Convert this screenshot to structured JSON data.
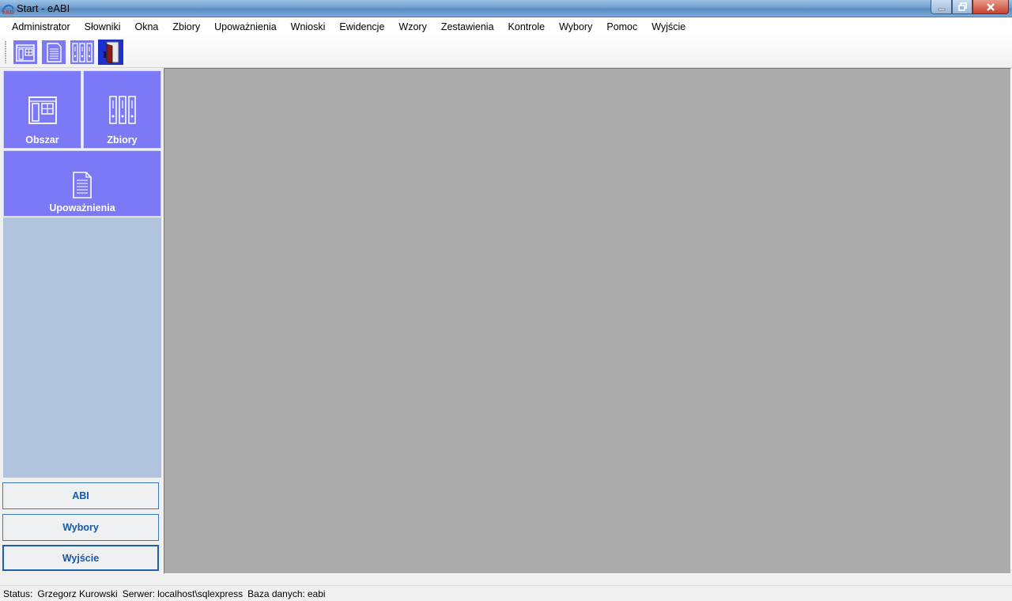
{
  "window": {
    "title": "Start - eABI",
    "app_icon": "eabi-logo-icon",
    "minimize_icon": "minimize-icon",
    "maximize_icon": "restore-icon",
    "close_icon": "close-icon"
  },
  "menu": {
    "items": [
      {
        "label": "Administrator"
      },
      {
        "label": "Słowniki"
      },
      {
        "label": "Okna"
      },
      {
        "label": "Zbiory"
      },
      {
        "label": "Upoważnienia"
      },
      {
        "label": "Wnioski"
      },
      {
        "label": "Ewidencje"
      },
      {
        "label": "Wzory"
      },
      {
        "label": "Zestawienia"
      },
      {
        "label": "Kontrole"
      },
      {
        "label": "Wybory"
      },
      {
        "label": "Pomoc"
      },
      {
        "label": "Wyjście"
      }
    ]
  },
  "toolbar": {
    "buttons": [
      {
        "icon": "obszar-icon"
      },
      {
        "icon": "document-icon"
      },
      {
        "icon": "binders-icon"
      },
      {
        "icon": "exit-door-icon"
      }
    ]
  },
  "sidebar": {
    "tiles": [
      {
        "label": "Obszar",
        "icon": "obszar-icon"
      },
      {
        "label": "Zbiory",
        "icon": "binders-icon"
      },
      {
        "label": "Upoważnienia",
        "icon": "document-icon"
      }
    ],
    "nav_buttons": [
      {
        "label": "ABI"
      },
      {
        "label": "Wybory"
      },
      {
        "label": "Wyjście"
      }
    ]
  },
  "status": {
    "status_label": "Status:",
    "user": "Grzegorz Kurowski",
    "server_label": "Serwer:",
    "server": "localhost\\sqlexpress",
    "db_label": "Baza danych:",
    "db": "eabi"
  },
  "colors": {
    "tile": "#7b79f6",
    "tile_area": "#b0c4de",
    "mdi_background": "#ababab",
    "nav_text": "#1659a8"
  }
}
